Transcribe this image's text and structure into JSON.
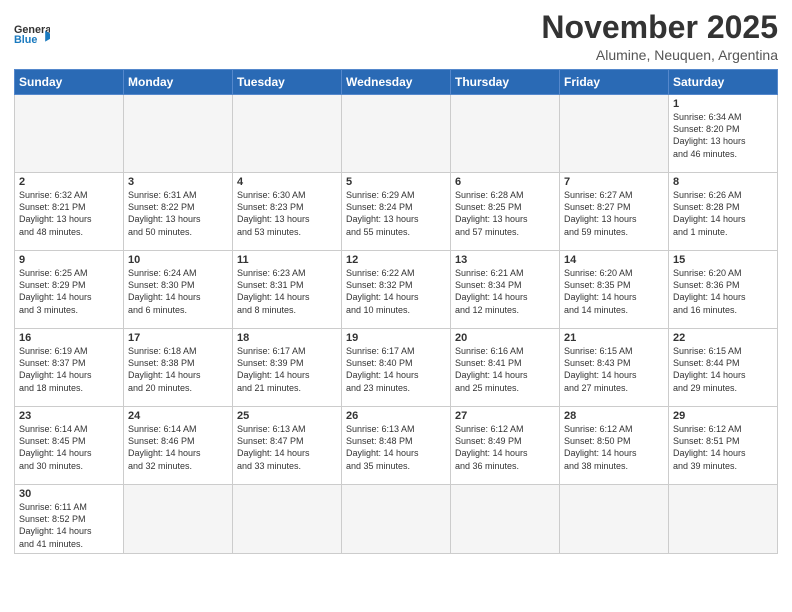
{
  "logo": {
    "general": "General",
    "blue": "Blue"
  },
  "header": {
    "title": "November 2025",
    "location": "Alumine, Neuquen, Argentina"
  },
  "days_of_week": [
    "Sunday",
    "Monday",
    "Tuesday",
    "Wednesday",
    "Thursday",
    "Friday",
    "Saturday"
  ],
  "weeks": [
    [
      {
        "day": "",
        "info": ""
      },
      {
        "day": "",
        "info": ""
      },
      {
        "day": "",
        "info": ""
      },
      {
        "day": "",
        "info": ""
      },
      {
        "day": "",
        "info": ""
      },
      {
        "day": "",
        "info": ""
      },
      {
        "day": "1",
        "info": "Sunrise: 6:34 AM\nSunset: 8:20 PM\nDaylight: 13 hours\nand 46 minutes."
      }
    ],
    [
      {
        "day": "2",
        "info": "Sunrise: 6:32 AM\nSunset: 8:21 PM\nDaylight: 13 hours\nand 48 minutes."
      },
      {
        "day": "3",
        "info": "Sunrise: 6:31 AM\nSunset: 8:22 PM\nDaylight: 13 hours\nand 50 minutes."
      },
      {
        "day": "4",
        "info": "Sunrise: 6:30 AM\nSunset: 8:23 PM\nDaylight: 13 hours\nand 53 minutes."
      },
      {
        "day": "5",
        "info": "Sunrise: 6:29 AM\nSunset: 8:24 PM\nDaylight: 13 hours\nand 55 minutes."
      },
      {
        "day": "6",
        "info": "Sunrise: 6:28 AM\nSunset: 8:25 PM\nDaylight: 13 hours\nand 57 minutes."
      },
      {
        "day": "7",
        "info": "Sunrise: 6:27 AM\nSunset: 8:27 PM\nDaylight: 13 hours\nand 59 minutes."
      },
      {
        "day": "8",
        "info": "Sunrise: 6:26 AM\nSunset: 8:28 PM\nDaylight: 14 hours\nand 1 minute."
      }
    ],
    [
      {
        "day": "9",
        "info": "Sunrise: 6:25 AM\nSunset: 8:29 PM\nDaylight: 14 hours\nand 3 minutes."
      },
      {
        "day": "10",
        "info": "Sunrise: 6:24 AM\nSunset: 8:30 PM\nDaylight: 14 hours\nand 6 minutes."
      },
      {
        "day": "11",
        "info": "Sunrise: 6:23 AM\nSunset: 8:31 PM\nDaylight: 14 hours\nand 8 minutes."
      },
      {
        "day": "12",
        "info": "Sunrise: 6:22 AM\nSunset: 8:32 PM\nDaylight: 14 hours\nand 10 minutes."
      },
      {
        "day": "13",
        "info": "Sunrise: 6:21 AM\nSunset: 8:34 PM\nDaylight: 14 hours\nand 12 minutes."
      },
      {
        "day": "14",
        "info": "Sunrise: 6:20 AM\nSunset: 8:35 PM\nDaylight: 14 hours\nand 14 minutes."
      },
      {
        "day": "15",
        "info": "Sunrise: 6:20 AM\nSunset: 8:36 PM\nDaylight: 14 hours\nand 16 minutes."
      }
    ],
    [
      {
        "day": "16",
        "info": "Sunrise: 6:19 AM\nSunset: 8:37 PM\nDaylight: 14 hours\nand 18 minutes."
      },
      {
        "day": "17",
        "info": "Sunrise: 6:18 AM\nSunset: 8:38 PM\nDaylight: 14 hours\nand 20 minutes."
      },
      {
        "day": "18",
        "info": "Sunrise: 6:17 AM\nSunset: 8:39 PM\nDaylight: 14 hours\nand 21 minutes."
      },
      {
        "day": "19",
        "info": "Sunrise: 6:17 AM\nSunset: 8:40 PM\nDaylight: 14 hours\nand 23 minutes."
      },
      {
        "day": "20",
        "info": "Sunrise: 6:16 AM\nSunset: 8:41 PM\nDaylight: 14 hours\nand 25 minutes."
      },
      {
        "day": "21",
        "info": "Sunrise: 6:15 AM\nSunset: 8:43 PM\nDaylight: 14 hours\nand 27 minutes."
      },
      {
        "day": "22",
        "info": "Sunrise: 6:15 AM\nSunset: 8:44 PM\nDaylight: 14 hours\nand 29 minutes."
      }
    ],
    [
      {
        "day": "23",
        "info": "Sunrise: 6:14 AM\nSunset: 8:45 PM\nDaylight: 14 hours\nand 30 minutes."
      },
      {
        "day": "24",
        "info": "Sunrise: 6:14 AM\nSunset: 8:46 PM\nDaylight: 14 hours\nand 32 minutes."
      },
      {
        "day": "25",
        "info": "Sunrise: 6:13 AM\nSunset: 8:47 PM\nDaylight: 14 hours\nand 33 minutes."
      },
      {
        "day": "26",
        "info": "Sunrise: 6:13 AM\nSunset: 8:48 PM\nDaylight: 14 hours\nand 35 minutes."
      },
      {
        "day": "27",
        "info": "Sunrise: 6:12 AM\nSunset: 8:49 PM\nDaylight: 14 hours\nand 36 minutes."
      },
      {
        "day": "28",
        "info": "Sunrise: 6:12 AM\nSunset: 8:50 PM\nDaylight: 14 hours\nand 38 minutes."
      },
      {
        "day": "29",
        "info": "Sunrise: 6:12 AM\nSunset: 8:51 PM\nDaylight: 14 hours\nand 39 minutes."
      }
    ],
    [
      {
        "day": "30",
        "info": "Sunrise: 6:11 AM\nSunset: 8:52 PM\nDaylight: 14 hours\nand 41 minutes."
      },
      {
        "day": "",
        "info": ""
      },
      {
        "day": "",
        "info": ""
      },
      {
        "day": "",
        "info": ""
      },
      {
        "day": "",
        "info": ""
      },
      {
        "day": "",
        "info": ""
      },
      {
        "day": "",
        "info": ""
      }
    ]
  ]
}
